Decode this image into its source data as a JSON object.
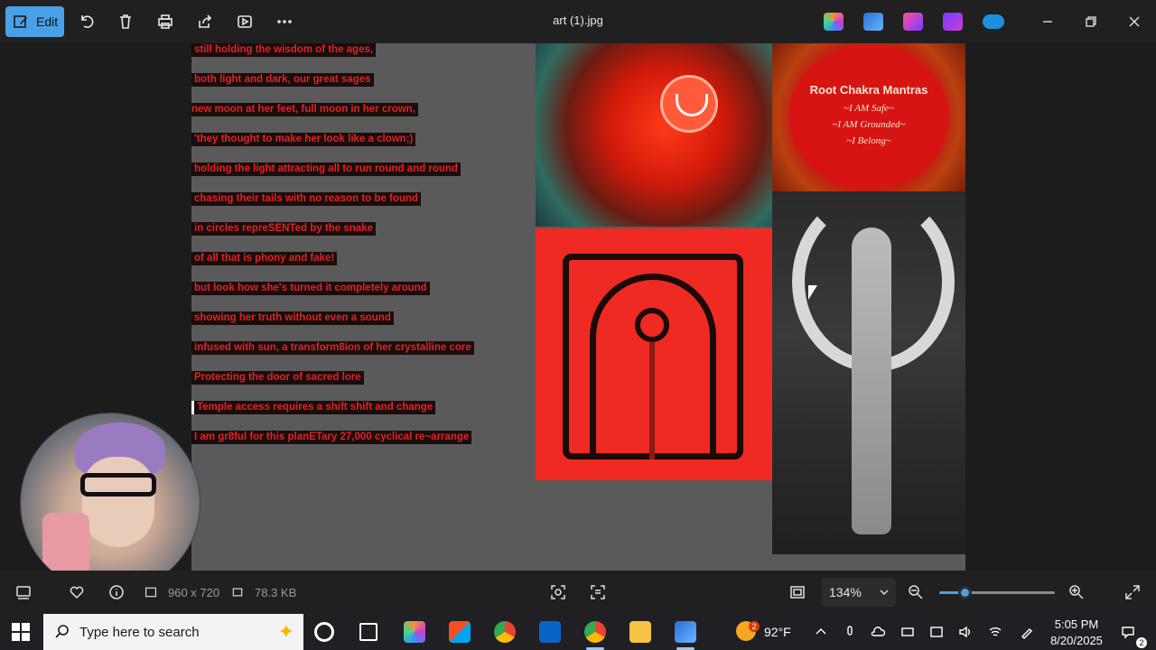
{
  "toolbar": {
    "edit_label": "Edit",
    "title": "art (1).jpg",
    "icons": [
      "rotate-icon",
      "delete-icon",
      "print-icon",
      "share-icon",
      "slideshow-icon",
      "more-icon"
    ],
    "apps": [
      "copilot-icon",
      "photos-editor-icon",
      "designer-icon",
      "clipchamp-icon",
      "onedrive-icon"
    ],
    "window": [
      "minimize-icon",
      "restore-icon",
      "close-icon"
    ]
  },
  "image": {
    "poem_lines": [
      "still holding the wisdom of the ages,",
      "both light and dark, our great sages",
      "new moon at her feet, full moon in her crown,",
      "'they thought to make her look like a clown;)",
      "holding the light attracting all to run round and round",
      "chasing their tails with no reason to be found",
      "in circles repreSENTed by the snake",
      "of all that is phony and fake!",
      "but look how she's turned it completely around",
      "showing her truth without even a sound",
      "infused with sun, a transform8ion of her crystalline core",
      "Protecting the door of sacred lore",
      "Temple access requires a shift shift and change",
      "I am gr8ful for this planETary 27,000 cyclical re~arrange"
    ],
    "mantra": {
      "title": "Root Chakra Mantras",
      "lines": [
        "~I AM Safe~",
        "~I AM Grounded~",
        "~I Belong~"
      ]
    },
    "colors": {
      "poem_text": "#e02222",
      "rune_bg": "#ee2a22",
      "mantra_bg": "#d71414"
    }
  },
  "statusbar": {
    "dimensions": "960 x 720",
    "filesize": "78.3 KB",
    "zoom": "134%",
    "zoom_level_fraction": 0.22,
    "icons": [
      "filmstrip-icon",
      "favorite-icon",
      "info-icon",
      "image-dimensions-icon",
      "storage-icon",
      "visual-search-icon",
      "scan-text-icon",
      "fit-window-icon",
      "zoom-out-icon",
      "zoom-in-icon",
      "fullscreen-icon"
    ]
  },
  "taskbar": {
    "search_placeholder": "Type here to search",
    "weather": "92°F",
    "weather_badge": "2",
    "time": "5:05 PM",
    "date": "8/20/2025",
    "notifications": "2",
    "apps": [
      "start-icon",
      "cortana-icon",
      "task-view-icon",
      "copilot-icon",
      "store-icon",
      "chrome-icon",
      "outlook-icon",
      "chrome-profile-icon",
      "file-explorer-icon",
      "photos-icon"
    ]
  }
}
